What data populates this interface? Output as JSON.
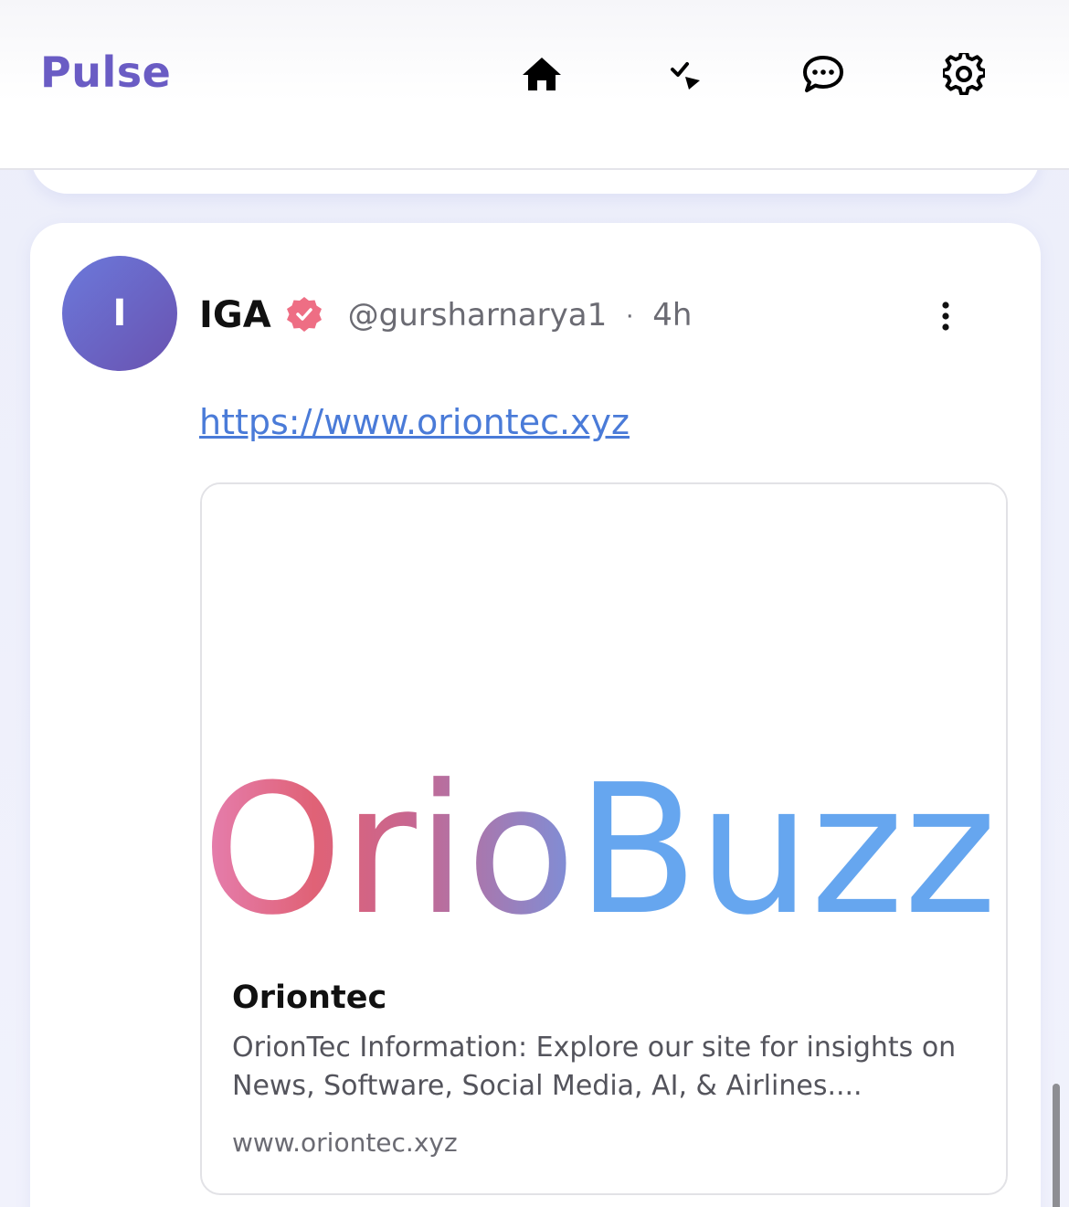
{
  "header": {
    "brand": "Pulse",
    "nav": [
      {
        "icon": "home-icon"
      },
      {
        "icon": "tasks-icon"
      },
      {
        "icon": "chat-icon"
      },
      {
        "icon": "settings-icon"
      }
    ]
  },
  "post": {
    "avatar_initial": "I",
    "author_name": "IGA",
    "verified_badge_icon": "verified-badge-icon",
    "handle": "@gursharnarya1",
    "separator": "·",
    "time": "4h",
    "link": "https://www.oriontec.xyz",
    "preview": {
      "image_text_left": "Orio",
      "image_text_right": "Buzz",
      "title": "Oriontec",
      "description": "OrionTec Information: Explore our site for insights on News, Software, Social Media, AI, & Airlines....",
      "domain": "www.oriontec.xyz"
    }
  },
  "colors": {
    "brand": "#6a5cc4",
    "link": "#4a7bd8",
    "badge": "#ee6e84",
    "logo_pink": "#e57fb0",
    "logo_red": "#e06276",
    "logo_blue": "#66a6ef"
  }
}
